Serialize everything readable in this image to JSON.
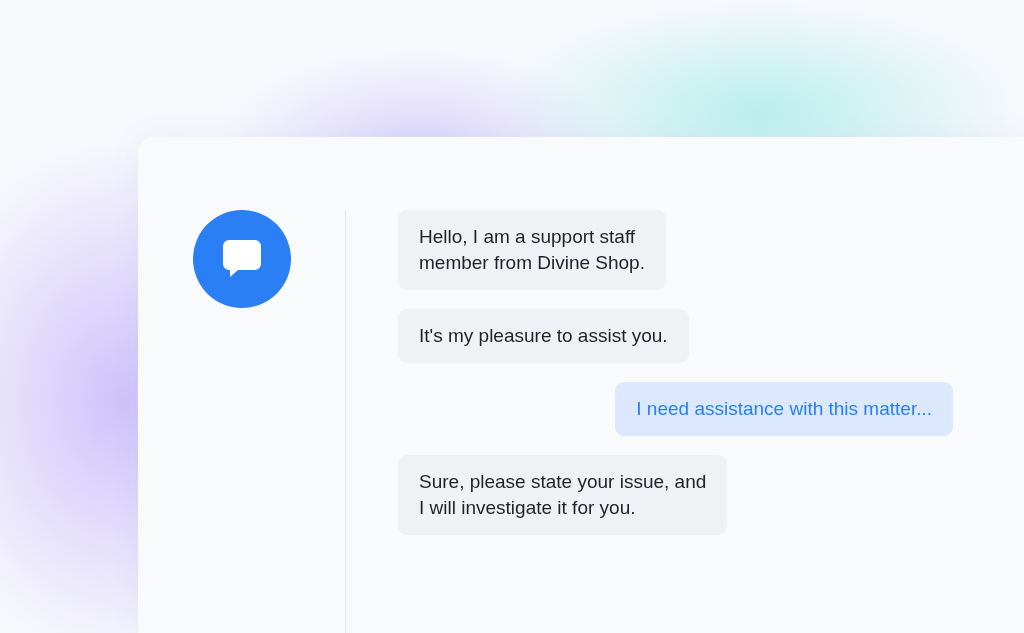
{
  "messages": [
    {
      "kind": "agent",
      "lines": [
        "Hello, I am a support staff",
        "member from Divine Shop."
      ]
    },
    {
      "kind": "agent",
      "lines": [
        "It's my pleasure to assist you."
      ]
    },
    {
      "kind": "user",
      "lines": [
        "I need assistance with this matter..."
      ]
    },
    {
      "kind": "agent",
      "lines": [
        "Sure, please state your issue, and",
        "I will investigate it for you."
      ]
    }
  ]
}
